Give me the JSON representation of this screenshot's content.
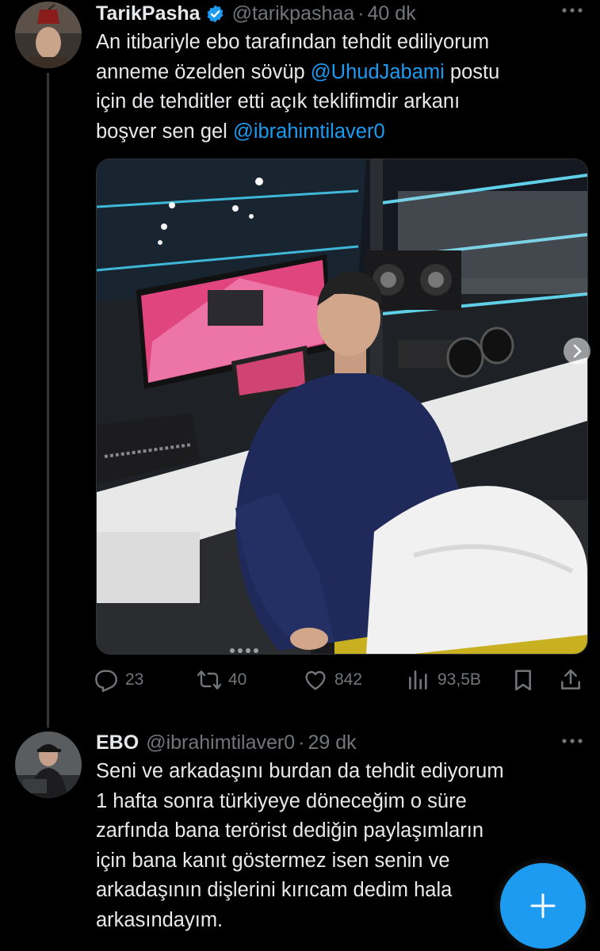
{
  "tweet1": {
    "display_name": "TarikPasha",
    "verified": true,
    "handle": "@tarikpashaa",
    "separator": "·",
    "time": "40 dk",
    "text_lines": [
      {
        "before": "An itibariyle ebo tarafından tehdit ediliyorum",
        "mention": "",
        "after": ""
      },
      {
        "before": "anneme özelden sövüp ",
        "mention": "@UhudJabami",
        "after": " postu"
      },
      {
        "before": "için de tehditler etti açık teklifimdir arkanı",
        "mention": "",
        "after": ""
      },
      {
        "before": "boşver sen gel ",
        "mention": "@ibrahimtilaver0",
        "after": ""
      }
    ],
    "media_icon": "photo-studio-image",
    "actions": {
      "reply": {
        "icon": "reply-icon",
        "count": "23"
      },
      "retweet": {
        "icon": "retweet-icon",
        "count": "40"
      },
      "like": {
        "icon": "heart-icon",
        "count": "842"
      },
      "views": {
        "icon": "views-icon",
        "count": "93,5B"
      },
      "bookmark": {
        "icon": "bookmark-icon"
      },
      "share": {
        "icon": "share-icon"
      }
    }
  },
  "tweet2": {
    "display_name": "EBO",
    "handle": "@ibrahimtilaver0",
    "separator": "·",
    "time": "29 dk",
    "text_lines": [
      "Seni ve arkadaşını burdan da tehdit ediyorum",
      "1 hafta sonra türkiyeye döneceğim o süre",
      "zarfında bana terörist dediğin paylaşımların",
      "için bana kanıt göstermez isen senin ve",
      "arkadaşının dişlerini kırıcam dedim hala",
      "arkasındayım."
    ]
  },
  "fab": {
    "icon": "compose-plus-icon"
  },
  "colors": {
    "background": "#000000",
    "text": "#e7e9ea",
    "secondary": "#71767b",
    "accent": "#1d9bf0",
    "divider": "#333639"
  }
}
